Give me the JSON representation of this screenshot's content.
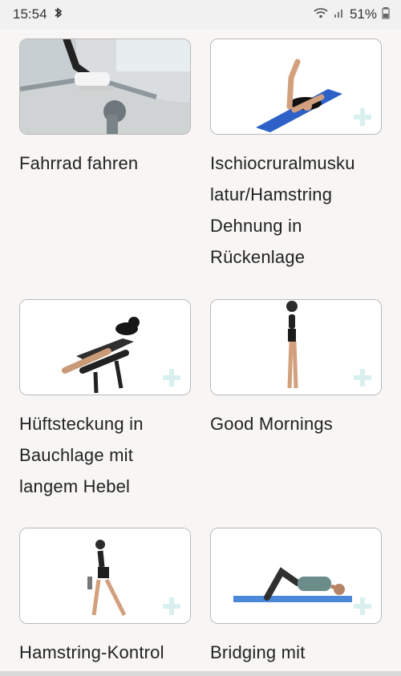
{
  "status_bar": {
    "time": "15:54",
    "bluetooth_icon": "bluetooth-icon",
    "wifi_icon": "wifi-icon",
    "signal_icon": "signal-icon",
    "battery_percent": "51%"
  },
  "exercises": [
    {
      "title": "Fahrrad fahren"
    },
    {
      "title": "Ischiocruralmusku latur/Hamstring Dehnung in Rückenlage"
    },
    {
      "title": "Hüftsteckung in Bauchlage mit langem Hebel"
    },
    {
      "title": "Good Mornings"
    },
    {
      "title": "Hamstring-Kontrol"
    },
    {
      "title": "Bridging mit"
    }
  ]
}
